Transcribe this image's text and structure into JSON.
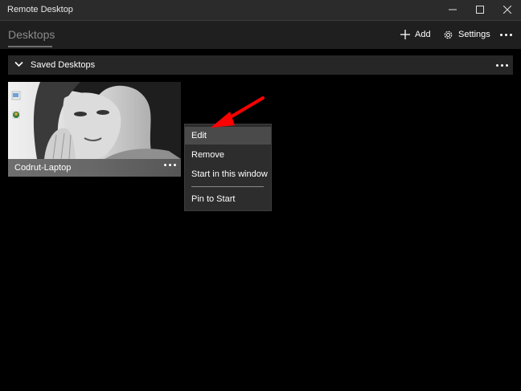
{
  "window": {
    "title": "Remote Desktop",
    "controls": [
      "minimize-icon",
      "maximize-icon",
      "close-icon"
    ]
  },
  "appbar": {
    "tab_label": "Desktops",
    "add_label": "Add",
    "settings_label": "Settings",
    "more_icon": "more-icon"
  },
  "group": {
    "label": "Saved Desktops",
    "expanded": true
  },
  "desktops": [
    {
      "name": "Codrut-Laptop"
    }
  ],
  "context_menu": {
    "items": [
      "Edit",
      "Remove",
      "Start in this window",
      "Pin to Start"
    ],
    "highlighted": "Edit"
  },
  "annotation": {
    "arrow_color": "#ff0000"
  }
}
